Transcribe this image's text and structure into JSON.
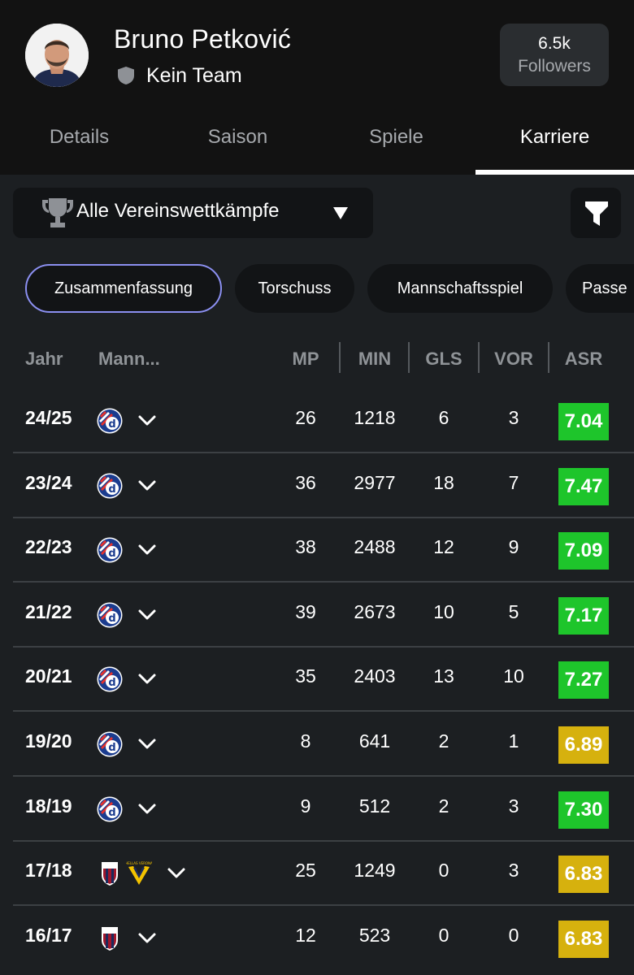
{
  "player": {
    "name": "Bruno Petković",
    "team": "Kein Team",
    "followers_count": "6.5k",
    "followers_label": "Followers"
  },
  "tabs": [
    {
      "label": "Details",
      "active": false
    },
    {
      "label": "Saison",
      "active": false
    },
    {
      "label": "Spiele",
      "active": false
    },
    {
      "label": "Karriere",
      "active": true
    }
  ],
  "competition_filter": {
    "selected": "Alle Vereinswettkämpfe",
    "icon": "trophy-icon"
  },
  "filter_button": {
    "icon": "filter-icon"
  },
  "chips": [
    {
      "label": "Zusammenfassung",
      "active": true
    },
    {
      "label": "Torschuss",
      "active": false
    },
    {
      "label": "Mannschaftsspiel",
      "active": false
    },
    {
      "label": "Passe",
      "active": false
    }
  ],
  "table": {
    "headers": [
      "Jahr",
      "Mann...",
      "MP",
      "MIN",
      "GLS",
      "VOR",
      "ASR"
    ],
    "rows": [
      {
        "year": "24/25",
        "clubs": [
          "dinamo"
        ],
        "mp": "26",
        "min": "1218",
        "gls": "6",
        "vor": "3",
        "asr": "7.04",
        "asr_color": "#1ec52b"
      },
      {
        "year": "23/24",
        "clubs": [
          "dinamo"
        ],
        "mp": "36",
        "min": "2977",
        "gls": "18",
        "vor": "7",
        "asr": "7.47",
        "asr_color": "#1ec52b"
      },
      {
        "year": "22/23",
        "clubs": [
          "dinamo"
        ],
        "mp": "38",
        "min": "2488",
        "gls": "12",
        "vor": "9",
        "asr": "7.09",
        "asr_color": "#1ec52b"
      },
      {
        "year": "21/22",
        "clubs": [
          "dinamo"
        ],
        "mp": "39",
        "min": "2673",
        "gls": "10",
        "vor": "5",
        "asr": "7.17",
        "asr_color": "#1ec52b"
      },
      {
        "year": "20/21",
        "clubs": [
          "dinamo"
        ],
        "mp": "35",
        "min": "2403",
        "gls": "13",
        "vor": "10",
        "asr": "7.27",
        "asr_color": "#1ec52b"
      },
      {
        "year": "19/20",
        "clubs": [
          "dinamo"
        ],
        "mp": "8",
        "min": "641",
        "gls": "2",
        "vor": "1",
        "asr": "6.89",
        "asr_color": "#d6b10e"
      },
      {
        "year": "18/19",
        "clubs": [
          "dinamo"
        ],
        "mp": "9",
        "min": "512",
        "gls": "2",
        "vor": "3",
        "asr": "7.30",
        "asr_color": "#1ec52b"
      },
      {
        "year": "17/18",
        "clubs": [
          "bologna",
          "verona"
        ],
        "mp": "25",
        "min": "1249",
        "gls": "0",
        "vor": "3",
        "asr": "6.83",
        "asr_color": "#d6b10e"
      },
      {
        "year": "16/17",
        "clubs": [
          "bologna"
        ],
        "mp": "12",
        "min": "523",
        "gls": "0",
        "vor": "0",
        "asr": "6.83",
        "asr_color": "#d6b10e"
      }
    ]
  },
  "colors": {
    "rating_good": "#1ec52b",
    "rating_mid": "#d6b10e",
    "active_chip_border": "#8b8ff0"
  }
}
